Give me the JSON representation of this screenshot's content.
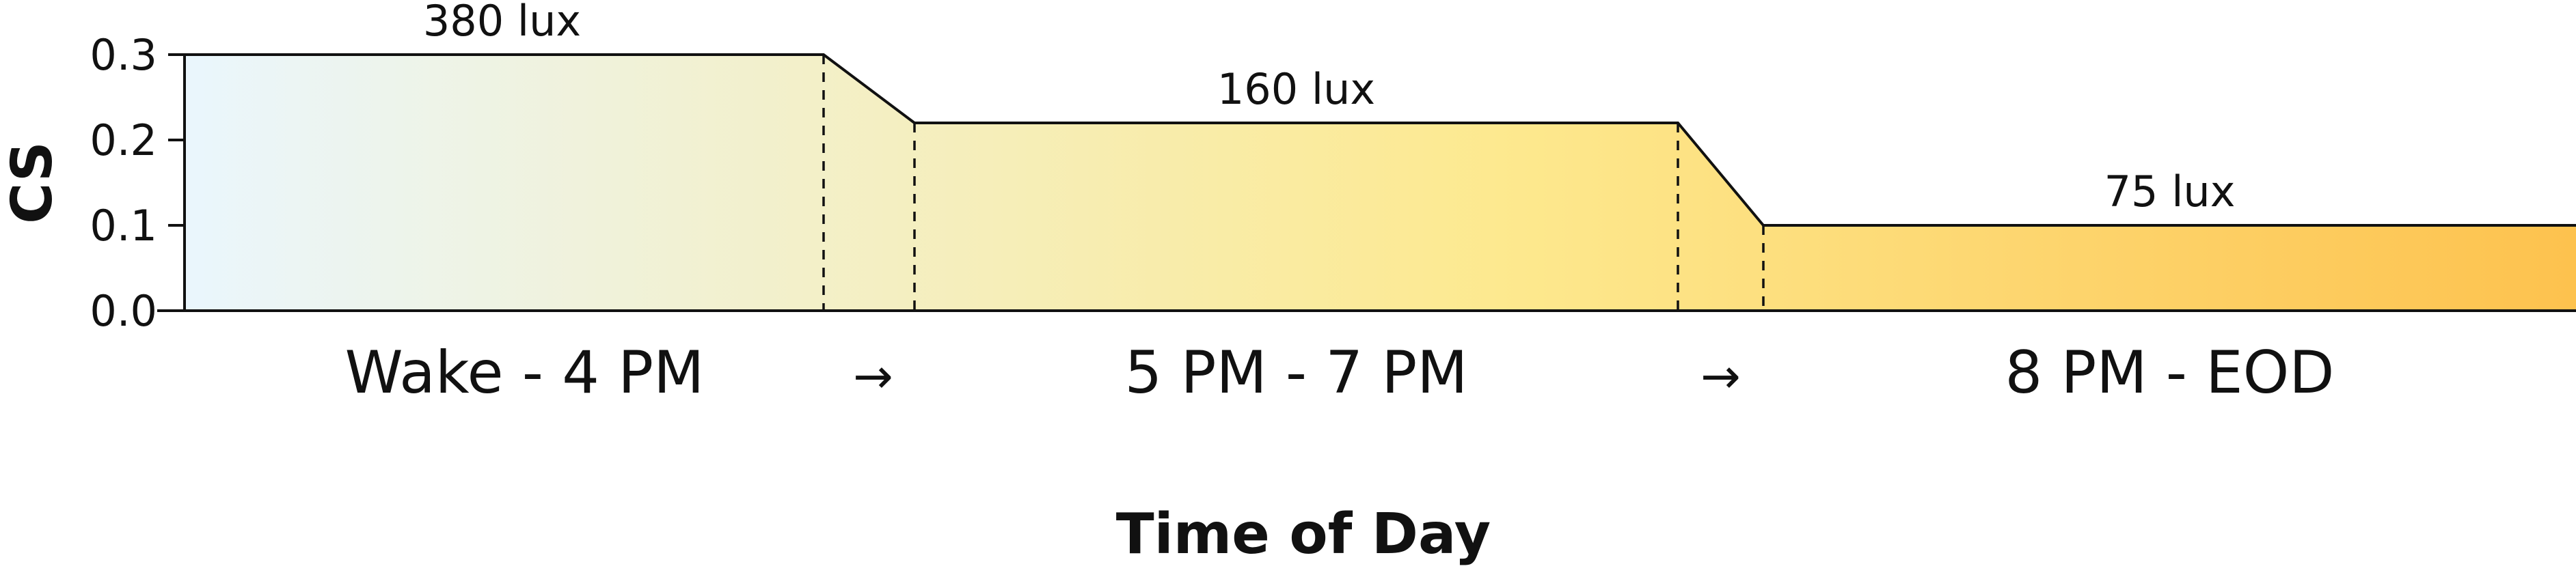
{
  "colors": {
    "gradient_start": "#eaf6fd",
    "gradient_mid": "#fde98f",
    "gradient_end": "#fdc24e",
    "line": "#111111"
  },
  "chart_data": {
    "type": "area",
    "title": "",
    "xlabel": "Time of Day",
    "ylabel": "CS",
    "ylim": [
      0.0,
      0.3
    ],
    "yticks": [
      "0.0",
      "0.1",
      "0.2",
      "0.3"
    ],
    "grid": false,
    "categories": [
      "Wake - 4 PM",
      "→",
      "5 PM - 7 PM",
      "→",
      "8 PM - EOD"
    ],
    "segments": [
      {
        "label": "Wake - 4 PM",
        "value": 0.3,
        "annotation": "380 lux"
      },
      {
        "label": "5 PM - 7 PM",
        "value": 0.22,
        "annotation": "160 lux"
      },
      {
        "label": "8 PM - EOD",
        "value": 0.1,
        "annotation": "75 lux"
      }
    ],
    "transitions": [
      "→",
      "→"
    ]
  }
}
